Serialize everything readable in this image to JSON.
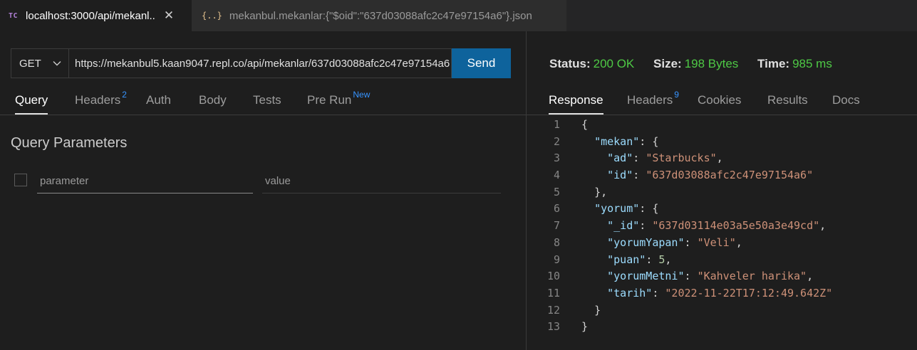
{
  "tabs": [
    {
      "icon": "TC",
      "label": "localhost:3000/api/mekanl..",
      "close": "✕"
    },
    {
      "icon": "{..}",
      "label": "mekanbul.mekanlar:{\"$oid\":\"637d03088afc2c47e97154a6\"}.json"
    }
  ],
  "request": {
    "method": "GET",
    "url": "https://mekanbul5.kaan9047.repl.co/api/mekanlar/637d03088afc2c47e97154a6",
    "send_label": "Send"
  },
  "request_tabs": [
    {
      "label": "Query",
      "badge": ""
    },
    {
      "label": "Headers",
      "badge": "2"
    },
    {
      "label": "Auth",
      "badge": ""
    },
    {
      "label": "Body",
      "badge": ""
    },
    {
      "label": "Tests",
      "badge": ""
    },
    {
      "label": "Pre Run",
      "badge": "New"
    }
  ],
  "query": {
    "title": "Query Parameters",
    "param_placeholder": "parameter",
    "value_placeholder": "value"
  },
  "status": {
    "status_label": "Status:",
    "status_value": "200 OK",
    "size_label": "Size:",
    "size_value": "198 Bytes",
    "time_label": "Time:",
    "time_value": "985 ms",
    "value_color": "#4ec945"
  },
  "response_tabs": [
    {
      "label": "Response",
      "badge": ""
    },
    {
      "label": "Headers",
      "badge": "9"
    },
    {
      "label": "Cookies",
      "badge": ""
    },
    {
      "label": "Results",
      "badge": ""
    },
    {
      "label": "Docs",
      "badge": ""
    }
  ],
  "response_lines": [
    {
      "n": "1",
      "indent": "",
      "tokens": [
        {
          "t": "{",
          "c": "p"
        }
      ]
    },
    {
      "n": "2",
      "indent": "  ",
      "tokens": [
        {
          "t": "\"mekan\"",
          "c": "k"
        },
        {
          "t": ": {",
          "c": "p"
        }
      ]
    },
    {
      "n": "3",
      "indent": "    ",
      "tokens": [
        {
          "t": "\"ad\"",
          "c": "k"
        },
        {
          "t": ": ",
          "c": "p"
        },
        {
          "t": "\"Starbucks\"",
          "c": "s"
        },
        {
          "t": ",",
          "c": "p"
        }
      ]
    },
    {
      "n": "4",
      "indent": "    ",
      "tokens": [
        {
          "t": "\"id\"",
          "c": "k"
        },
        {
          "t": ": ",
          "c": "p"
        },
        {
          "t": "\"637d03088afc2c47e97154a6\"",
          "c": "s"
        }
      ]
    },
    {
      "n": "5",
      "indent": "  ",
      "tokens": [
        {
          "t": "},",
          "c": "p"
        }
      ]
    },
    {
      "n": "6",
      "indent": "  ",
      "tokens": [
        {
          "t": "\"yorum\"",
          "c": "k"
        },
        {
          "t": ": {",
          "c": "p"
        }
      ]
    },
    {
      "n": "7",
      "indent": "    ",
      "tokens": [
        {
          "t": "\"_id\"",
          "c": "k"
        },
        {
          "t": ": ",
          "c": "p"
        },
        {
          "t": "\"637d03114e03a5e50a3e49cd\"",
          "c": "s"
        },
        {
          "t": ",",
          "c": "p"
        }
      ]
    },
    {
      "n": "8",
      "indent": "    ",
      "tokens": [
        {
          "t": "\"yorumYapan\"",
          "c": "k"
        },
        {
          "t": ": ",
          "c": "p"
        },
        {
          "t": "\"Veli\"",
          "c": "s"
        },
        {
          "t": ",",
          "c": "p"
        }
      ]
    },
    {
      "n": "9",
      "indent": "    ",
      "tokens": [
        {
          "t": "\"puan\"",
          "c": "k"
        },
        {
          "t": ": ",
          "c": "p"
        },
        {
          "t": "5",
          "c": "n"
        },
        {
          "t": ",",
          "c": "p"
        }
      ]
    },
    {
      "n": "10",
      "indent": "    ",
      "tokens": [
        {
          "t": "\"yorumMetni\"",
          "c": "k"
        },
        {
          "t": ": ",
          "c": "p"
        },
        {
          "t": "\"Kahveler harika\"",
          "c": "s"
        },
        {
          "t": ",",
          "c": "p"
        }
      ]
    },
    {
      "n": "11",
      "indent": "    ",
      "tokens": [
        {
          "t": "\"tarih\"",
          "c": "k"
        },
        {
          "t": ": ",
          "c": "p"
        },
        {
          "t": "\"2022-11-22T17:12:49.642Z\"",
          "c": "s"
        }
      ]
    },
    {
      "n": "12",
      "indent": "  ",
      "tokens": [
        {
          "t": "}",
          "c": "p"
        }
      ]
    },
    {
      "n": "13",
      "indent": "",
      "tokens": [
        {
          "t": "}",
          "c": "p"
        }
      ]
    }
  ],
  "colors": {
    "accent": "#0e639c",
    "badge": "#3794ff",
    "key": "#9cdcfe",
    "string": "#ce9178",
    "number": "#b5cea8"
  }
}
